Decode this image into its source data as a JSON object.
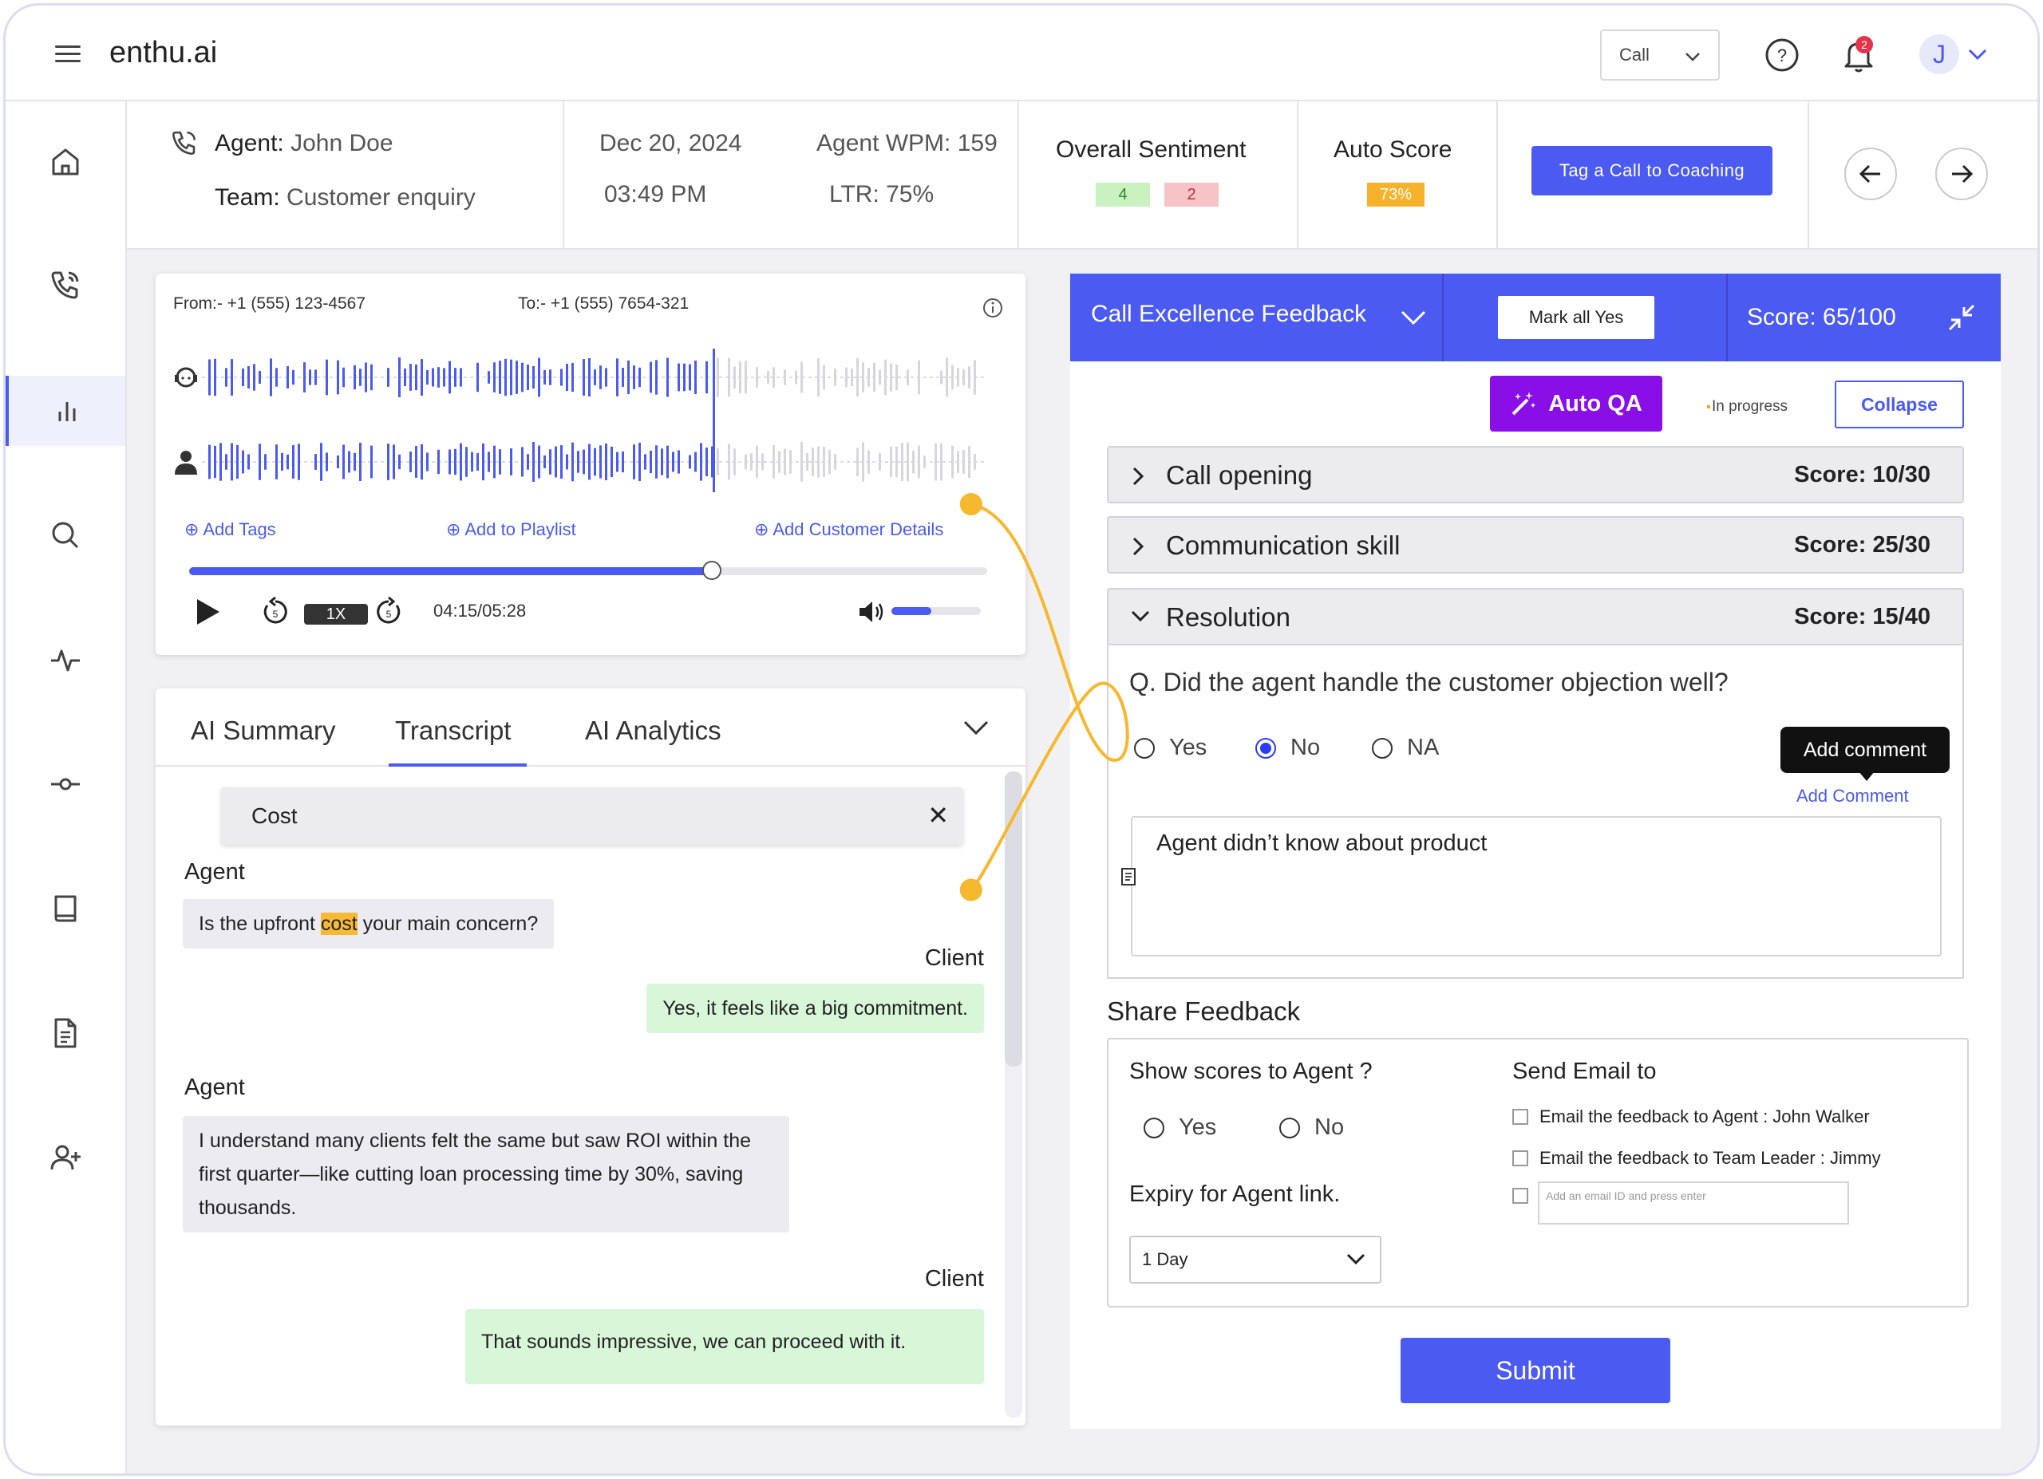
{
  "brand": "enthu.ai",
  "topbar": {
    "call_select": "Call",
    "notification_count": "2",
    "avatar_initial": "J"
  },
  "call_info": {
    "agent_label": "Agent:",
    "agent_name": "John Doe",
    "team_label": "Team:",
    "team_name": "Customer enquiry",
    "date": "Dec 20, 2024",
    "time": "03:49 PM",
    "wpm": "Agent WPM: 159",
    "ltr": "LTR: 75%",
    "sentiment_label": "Overall Sentiment",
    "sentiment_positive": "4",
    "sentiment_negative": "2",
    "auto_score_label": "Auto Score",
    "auto_score_value": "73%",
    "tag_button": "Tag a Call to Coaching"
  },
  "player": {
    "from": "From:- +1 (555) 123-4567",
    "to": "To:- +1 (555) 7654-321",
    "add_tags": "Add Tags",
    "add_playlist": "Add to Playlist",
    "add_customer": "Add Customer Details",
    "speed": "1X",
    "time": "04:15/05:28",
    "progress": 0.655,
    "volume": 0.45
  },
  "transcript": {
    "tabs": [
      "AI Summary",
      "Transcript",
      "AI Analytics"
    ],
    "active_tab": "Transcript",
    "search_term": "Cost",
    "messages": [
      {
        "speaker": "Agent",
        "pre": "Is the upfront ",
        "highlight": "cost",
        "post": " your main concern?"
      },
      {
        "speaker": "Client",
        "text": "Yes, it feels like a big commitment."
      },
      {
        "speaker": "Agent",
        "text": "I understand many clients felt the same but saw ROI within the first quarter—like cutting loan processing time by 30%, saving thousands."
      },
      {
        "speaker": "Client",
        "text": "That sounds impressive, we can proceed with it."
      }
    ]
  },
  "feedback": {
    "title": "Call Excellence Feedback",
    "mark_all_yes": "Mark all Yes",
    "score": "Score: 65/100",
    "auto_qa": "Auto QA",
    "in_progress": "In progress",
    "collapse": "Collapse",
    "sections": [
      {
        "name": "Call opening",
        "score": "Score: 10/30"
      },
      {
        "name": "Communication skill",
        "score": "Score: 25/30"
      },
      {
        "name": "Resolution",
        "score": "Score: 15/40"
      }
    ],
    "question": "Q. Did the agent handle the customer objection well?",
    "options": [
      "Yes",
      "No",
      "NA"
    ],
    "selected_option": "No",
    "tooltip": "Add comment",
    "add_comment": "Add Comment",
    "comment": "Agent didn’t know about product",
    "share_title": "Share Feedback",
    "show_scores_label": "Show scores to Agent ?",
    "show_scores_options": [
      "Yes",
      "No"
    ],
    "send_email_label": "Send Email to",
    "email_agent": "Email the feedback to Agent : John Walker",
    "email_leader": "Email the feedback to Team Leader : Jimmy",
    "email_placeholder": "Add an email ID and press enter",
    "expiry_label": "Expiry for Agent link.",
    "expiry_value": "1 Day",
    "submit": "Submit"
  },
  "colors": {
    "accent": "#4b5af0",
    "auto_qa": "#8a0ee6",
    "connector": "#f5b82e",
    "positive_chip": "#c9f2c0",
    "negative_chip": "#f6c3c6",
    "score_chip": "#f6b22a"
  },
  "icons": [
    "menu-icon",
    "help-icon",
    "bell-icon",
    "home-icon",
    "phone-icon",
    "analytics-icon",
    "search-icon",
    "pulse-icon",
    "commit-icon",
    "book-icon",
    "document-icon",
    "add-user-icon",
    "arrow-left-icon",
    "arrow-right-icon",
    "info-icon",
    "play-icon",
    "rewind-icon",
    "forward-icon",
    "volume-icon",
    "minimize-icon",
    "magic-wand-icon"
  ]
}
